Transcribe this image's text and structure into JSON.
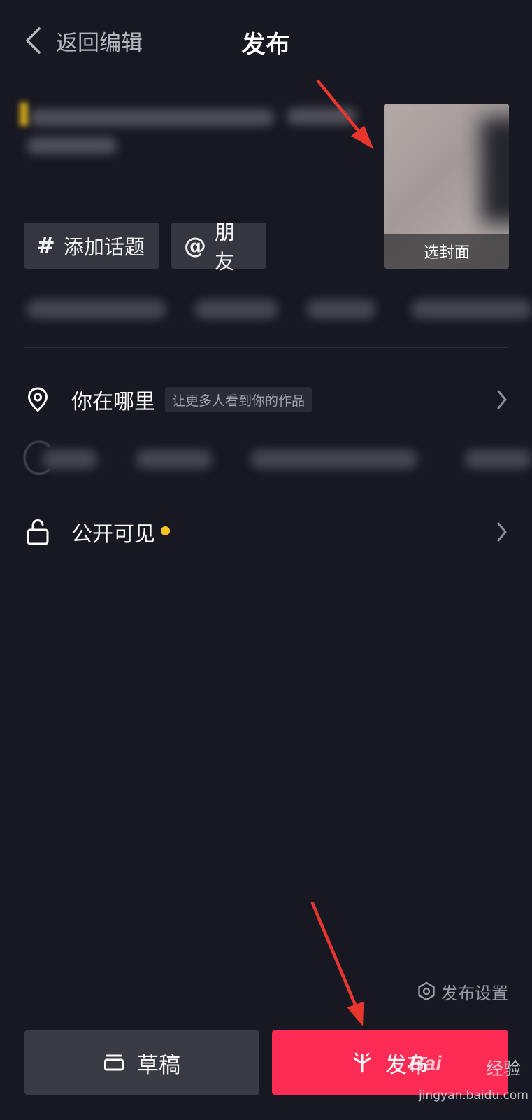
{
  "header": {
    "back_label": "返回编辑",
    "title": "发布"
  },
  "cover": {
    "label": "选封面"
  },
  "chips": {
    "topic_glyph": "#",
    "topic_label": "添加话题",
    "friend_glyph": "@",
    "friend_label": "朋友"
  },
  "location": {
    "label": "你在哪里",
    "hint": "让更多人看到你的作品"
  },
  "visibility": {
    "label": "公开可见",
    "dot_color": "#f6c624"
  },
  "settings": {
    "label": "发布设置"
  },
  "actions": {
    "draft_label": "草稿",
    "publish_label": "发布",
    "publish_color": "#fe2c55"
  },
  "watermark": {
    "logo": "Bai",
    "brand": "经验",
    "domain": "jingyan.baidu.com"
  }
}
